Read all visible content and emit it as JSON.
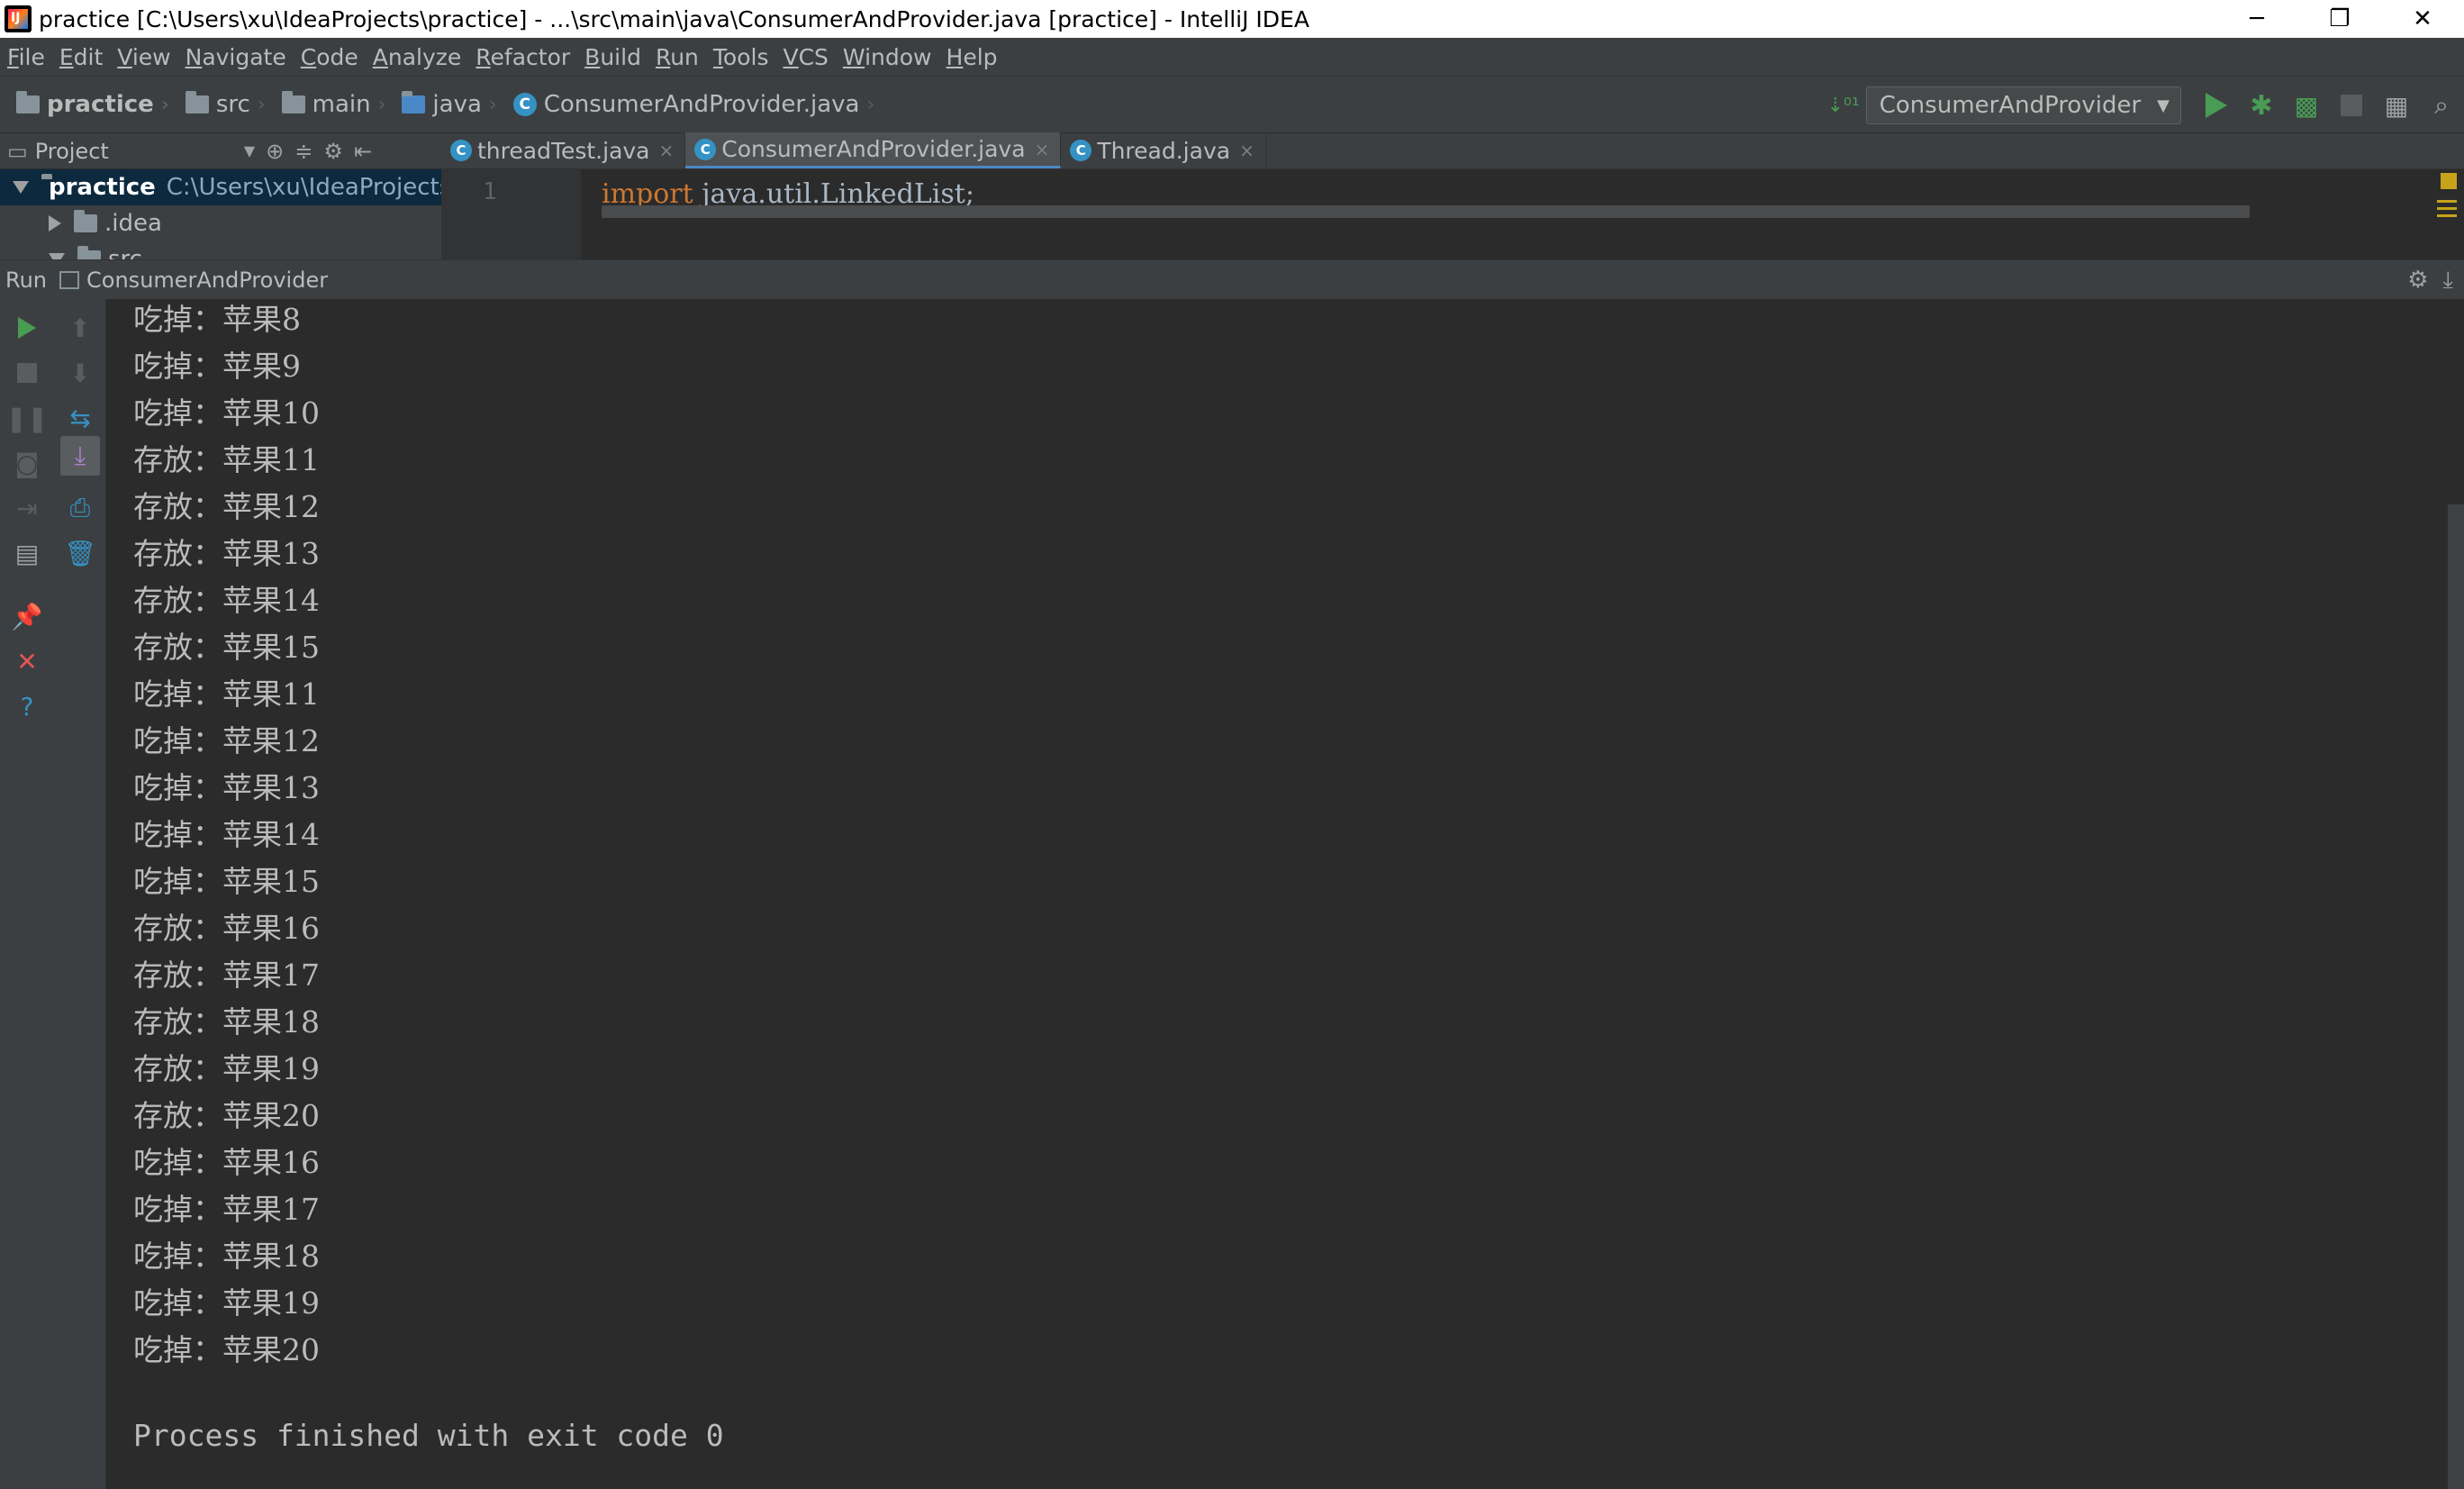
{
  "window": {
    "title": "practice [C:\\Users\\xu\\IdeaProjects\\practice] - ...\\src\\main\\java\\ConsumerAndProvider.java [practice] - IntelliJ IDEA",
    "logo_text": "IJ",
    "minimize": "─",
    "restore": "❐",
    "close": "✕"
  },
  "menu": [
    "File",
    "Edit",
    "View",
    "Navigate",
    "Code",
    "Analyze",
    "Refactor",
    "Build",
    "Run",
    "Tools",
    "VCS",
    "Window",
    "Help"
  ],
  "breadcrumb": {
    "project": "practice",
    "src": "src",
    "main": "main",
    "java": "java",
    "file": "ConsumerAndProvider.java"
  },
  "run_config": {
    "name": "ConsumerAndProvider"
  },
  "project_panel": {
    "label": "Project",
    "root_name": "practice",
    "root_path": "C:\\Users\\xu\\IdeaProjects\\practice",
    "child_idea": ".idea",
    "child_src": "src"
  },
  "editor_tabs": [
    {
      "label": "threadTest.java"
    },
    {
      "label": "ConsumerAndProvider.java"
    },
    {
      "label": "Thread.java"
    }
  ],
  "editor": {
    "line_number": "1",
    "keyword": "import",
    "code_rest": " java.util.LinkedList;"
  },
  "run_panel": {
    "label": "Run",
    "config": "ConsumerAndProvider"
  },
  "console": {
    "lines": [
      "吃掉：苹果8",
      "吃掉：苹果9",
      "吃掉：苹果10",
      "存放：苹果11",
      "存放：苹果12",
      "存放：苹果13",
      "存放：苹果14",
      "存放：苹果15",
      "吃掉：苹果11",
      "吃掉：苹果12",
      "吃掉：苹果13",
      "吃掉：苹果14",
      "吃掉：苹果15",
      "存放：苹果16",
      "存放：苹果17",
      "存放：苹果18",
      "存放：苹果19",
      "存放：苹果20",
      "吃掉：苹果16",
      "吃掉：苹果17",
      "吃掉：苹果18",
      "吃掉：苹果19",
      "吃掉：苹果20"
    ],
    "exit": "Process finished with exit code 0"
  }
}
